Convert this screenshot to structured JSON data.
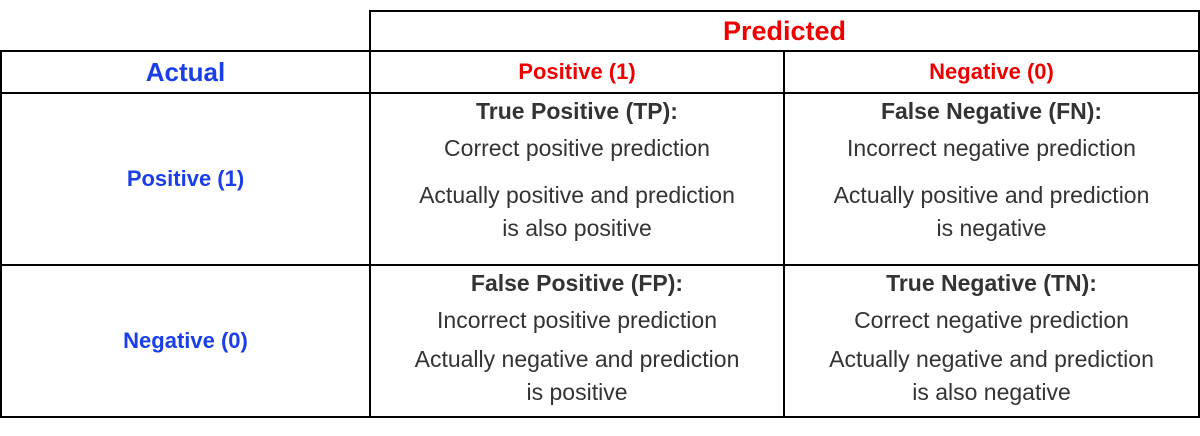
{
  "header": {
    "predicted": "Predicted",
    "actual": "Actual"
  },
  "columns": [
    {
      "label": "Positive (1)"
    },
    {
      "label": "Negative (0)"
    }
  ],
  "rows": [
    {
      "label": "Positive (1)"
    },
    {
      "label": "Negative (0)"
    }
  ],
  "cells": {
    "tp": {
      "title": "True Positive (TP):",
      "short": "Correct positive prediction",
      "long_1": "Actually positive and prediction",
      "long_2": "is also positive"
    },
    "fn": {
      "title": "False Negative (FN):",
      "short": "Incorrect negative prediction",
      "long_1": "Actually positive and prediction",
      "long_2": "is negative"
    },
    "fp": {
      "title": "False Positive (FP):",
      "short": "Incorrect positive prediction",
      "long_1": "Actually negative and prediction",
      "long_2": "is positive"
    },
    "tn": {
      "title": "True Negative (TN):",
      "short": "Correct negative prediction",
      "long_1": "Actually negative and prediction",
      "long_2": "is also negative"
    }
  },
  "colors": {
    "predicted_header": "#ee0000",
    "actual_header": "#1a3ee8",
    "body_text": "#333333",
    "grid_line": "#000000"
  }
}
